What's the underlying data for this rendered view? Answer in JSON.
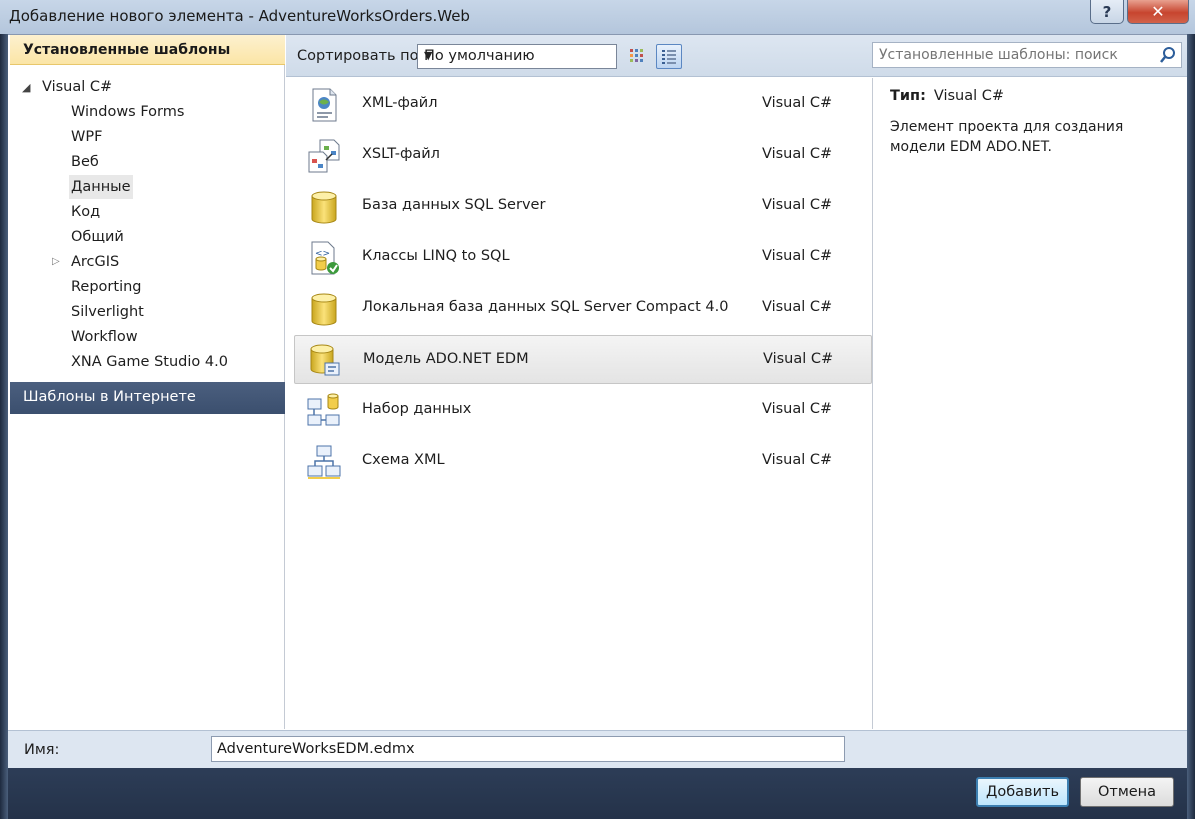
{
  "window": {
    "title": "Добавление нового элемента - AdventureWorksOrders.Web",
    "help_glyph": "?",
    "close_glyph": "✕"
  },
  "left_panel": {
    "installed_header": "Установленные шаблоны",
    "root": "Visual C#",
    "children": [
      "Windows Forms",
      "WPF",
      "Веб",
      "Данные",
      "Код",
      "Общий",
      "ArcGIS",
      "Reporting",
      "Silverlight",
      "Workflow",
      "XNA Game Studio 4.0"
    ],
    "selected_child": "Данные",
    "online_header": "Шаблоны в Интернете"
  },
  "toolbar": {
    "sort_label": "Сортировать по:",
    "sort_value": "По умолчанию",
    "search_placeholder": "Установленные шаблоны: поиск"
  },
  "templates": [
    {
      "name": "XML-файл",
      "lang": "Visual C#",
      "icon": "xml-file-icon"
    },
    {
      "name": "XSLT-файл",
      "lang": "Visual C#",
      "icon": "xslt-file-icon"
    },
    {
      "name": "База данных SQL Server",
      "lang": "Visual C#",
      "icon": "database-icon"
    },
    {
      "name": "Классы LINQ to SQL",
      "lang": "Visual C#",
      "icon": "linq-classes-icon"
    },
    {
      "name": "Локальная база данных SQL Server Compact 4.0",
      "lang": "Visual C#",
      "icon": "database-icon"
    },
    {
      "name": "Модель ADO.NET EDM",
      "lang": "Visual C#",
      "icon": "edm-model-icon"
    },
    {
      "name": "Набор данных",
      "lang": "Visual C#",
      "icon": "dataset-icon"
    },
    {
      "name": "Схема XML",
      "lang": "Visual C#",
      "icon": "xml-schema-icon"
    }
  ],
  "selected_template": "Модель ADO.NET EDM",
  "description": {
    "type_label": "Тип:",
    "type_value": "Visual C#",
    "text": "Элемент проекта для создания модели EDM ADO.NET."
  },
  "bottom": {
    "name_label": "Имя:",
    "name_value": "AdventureWorksEDM.edmx",
    "add_button": "Добавить",
    "cancel_button": "Отмена"
  },
  "colors": {
    "installed_header_bg": "#fbe5a6",
    "online_header_bg": "#3b4f6e",
    "toolbar_bg": "#dde6f1",
    "close_button": "#c7452f"
  }
}
